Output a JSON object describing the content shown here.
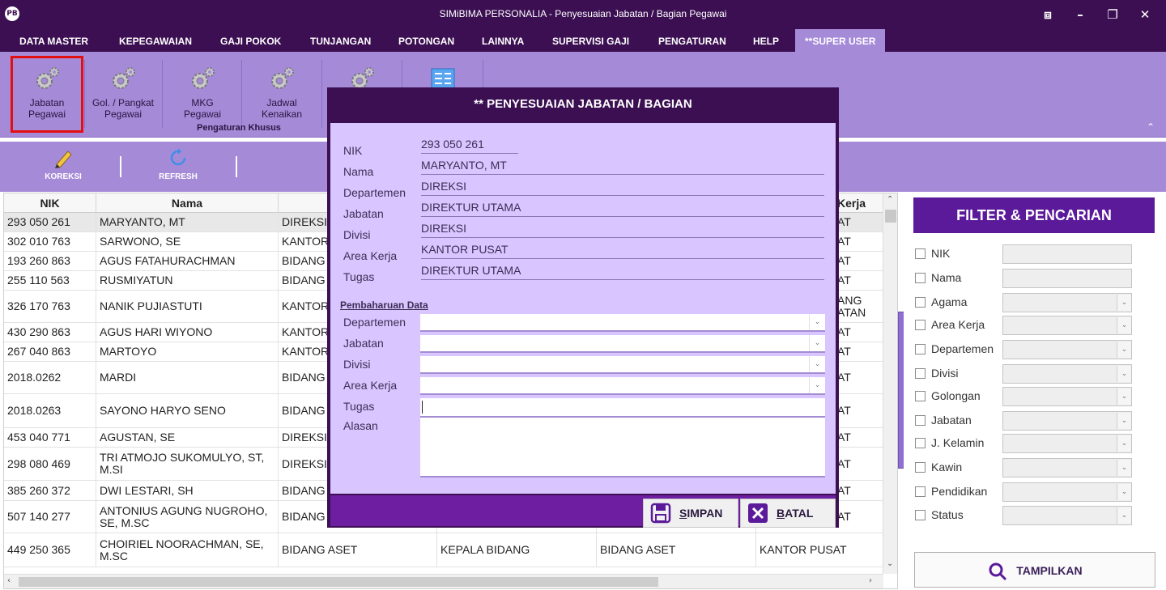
{
  "window": {
    "title": "SIMiBIMA PERSONALIA - Penyesuaian Jabatan / Bagian Pegawai",
    "logo_text": "PB",
    "restore_glyph": "⧈",
    "minimize_glyph": "–",
    "maximize_glyph": "❐",
    "close_glyph": "✕"
  },
  "menu": [
    "DATA MASTER",
    "KEPEGAWAIAN",
    "GAJI POKOK",
    "TUNJANGAN",
    "POTONGAN",
    "LAINNYA",
    "SUPERVISI GAJI",
    "PENGATURAN",
    "HELP",
    "**SUPER USER"
  ],
  "ribbon": {
    "buttons": [
      {
        "label_line1": "Jabatan",
        "label_line2": "Pegawai",
        "icon": "gear-icon"
      },
      {
        "label_line1": "Gol. / Pangkat",
        "label_line2": "Pegawai",
        "icon": "gear-icon"
      },
      {
        "label_line1": "MKG",
        "label_line2": "Pegawai",
        "icon": "gear-icon"
      },
      {
        "label_line1": "Jadwal",
        "label_line2": "Kenaikan",
        "icon": "gear-icon"
      },
      {
        "label_line1": "",
        "label_line2": "",
        "icon": "gear-icon"
      },
      {
        "label_line1": "",
        "label_line2": "",
        "icon": "list-icon"
      }
    ],
    "group_label": "Pengaturan Khusus",
    "collapse_glyph": "⌃"
  },
  "toolbar": {
    "koreksi": "KOREKSI",
    "refresh": "REFRESH"
  },
  "grid": {
    "columns": [
      "NIK",
      "Nama",
      "D",
      "",
      "",
      "Kerja"
    ],
    "rows": [
      {
        "nik": "293 050 261",
        "nama": "MARYANTO, MT",
        "dept": "DIREKSI",
        "jabatan": "",
        "divisi": "",
        "area": "AT",
        "selected": true
      },
      {
        "nik": "302 010 763",
        "nama": "SARWONO, SE",
        "dept": "KANTOR",
        "jabatan": "",
        "divisi": "",
        "area": "AT"
      },
      {
        "nik": "193 260 863",
        "nama": "AGUS FATAHURACHMAN",
        "dept": "BIDANG",
        "jabatan": "",
        "divisi": "",
        "area": "AT"
      },
      {
        "nik": "255 110 563",
        "nama": "RUSMIYATUN",
        "dept": "BIDANG",
        "jabatan": "",
        "divisi": "",
        "area": "AT"
      },
      {
        "nik": "326 170 763",
        "nama": "NANIK PUJIASTUTI",
        "dept": "KANTOR",
        "jabatan": "",
        "divisi": "",
        "area": "ANG\nATAN"
      },
      {
        "nik": "430 290 863",
        "nama": "AGUS HARI WIYONO",
        "dept": "KANTOR",
        "jabatan": "",
        "divisi": "",
        "area": "AT"
      },
      {
        "nik": "267 040 863",
        "nama": "MARTOYO",
        "dept": "KANTOR",
        "jabatan": "",
        "divisi": "",
        "area": "AT"
      },
      {
        "nik": "2018.0262",
        "nama": "MARDI",
        "dept": "BIDANG",
        "jabatan": "",
        "divisi": "",
        "area": "AT"
      },
      {
        "nik": "2018.0263",
        "nama": "SAYONO HARYO SENO",
        "dept": "BIDANG",
        "jabatan": "",
        "divisi": "",
        "area": "AT"
      },
      {
        "nik": "453 040 771",
        "nama": "AGUSTAN, SE",
        "dept": "DIREKSI",
        "jabatan": "",
        "divisi": "",
        "area": "AT"
      },
      {
        "nik": "298 080 469",
        "nama": "TRI ATMOJO SUKOMULYO, ST, M.SI",
        "dept": "DIREKSI",
        "jabatan": "",
        "divisi": "",
        "area": "AT"
      },
      {
        "nik": "385 260 372",
        "nama": "DWI LESTARI, SH",
        "dept": "BIDANG",
        "jabatan": "",
        "divisi": "",
        "area": "AT"
      },
      {
        "nik": "507 140 277",
        "nama": "ANTONIUS AGUNG NUGROHO, SE, M.SC",
        "dept": "BIDANG",
        "jabatan": "",
        "divisi": "",
        "area": "AT"
      },
      {
        "nik": "449 250 365",
        "nama": "CHOIRIEL NOORACHMAN, SE, M.SC",
        "dept": "BIDANG ASET",
        "jabatan": "KEPALA BIDANG",
        "divisi": "BIDANG ASET",
        "area": "KANTOR PUSAT"
      }
    ]
  },
  "filter": {
    "title": "FILTER & PENCARIAN",
    "fields": [
      {
        "label": "NIK",
        "type": "text"
      },
      {
        "label": "Nama",
        "type": "text"
      },
      {
        "label": "Agama",
        "type": "select"
      },
      {
        "label": "Area Kerja",
        "type": "select"
      },
      {
        "label": "Departemen",
        "type": "select"
      },
      {
        "label": "Divisi",
        "type": "select"
      },
      {
        "label": "Golongan",
        "type": "select"
      },
      {
        "label": "Jabatan",
        "type": "select"
      },
      {
        "label": "J. Kelamin",
        "type": "select"
      },
      {
        "label": "Kawin",
        "type": "select"
      },
      {
        "label": "Pendidikan",
        "type": "select"
      },
      {
        "label": "Status",
        "type": "select"
      }
    ],
    "button": "TAMPILKAN"
  },
  "dialog": {
    "title": "** PENYESUAIAN JABATAN / BAGIAN",
    "info": [
      {
        "label": "NIK",
        "value": "293 050 261"
      },
      {
        "label": "Nama",
        "value": "MARYANTO, MT"
      },
      {
        "label": "Departemen",
        "value": "DIREKSI"
      },
      {
        "label": "Jabatan",
        "value": "DIREKTUR UTAMA"
      },
      {
        "label": "Divisi",
        "value": "DIREKSI"
      },
      {
        "label": "Area Kerja",
        "value": "KANTOR PUSAT"
      },
      {
        "label": "Tugas",
        "value": "DIREKTUR UTAMA"
      }
    ],
    "section_label": "Pembaharuan Data",
    "form": [
      {
        "label": "Departemen",
        "type": "select",
        "value": ""
      },
      {
        "label": "Jabatan",
        "type": "select",
        "value": ""
      },
      {
        "label": "Divisi",
        "type": "select",
        "value": ""
      },
      {
        "label": "Area Kerja",
        "type": "select",
        "value": ""
      },
      {
        "label": "Tugas",
        "type": "text",
        "value": ""
      },
      {
        "label": "Alasan",
        "type": "textarea",
        "value": ""
      }
    ],
    "save_label_first": "S",
    "save_label_rest": "IMPAN",
    "cancel_label_first": "B",
    "cancel_label_rest": "ATAL"
  },
  "glyphs": {
    "dropdown": "⌄",
    "scroll_up": "⌃",
    "scroll_down": "⌄",
    "scroll_left": "‹",
    "scroll_right": "›"
  },
  "colors": {
    "title_bar": "#3b0f52",
    "ribbon": "#a58ad8",
    "dialog_body": "#d9c5ff",
    "filter_header": "#5b1a9a",
    "highlight_box": "#e30f0f"
  }
}
